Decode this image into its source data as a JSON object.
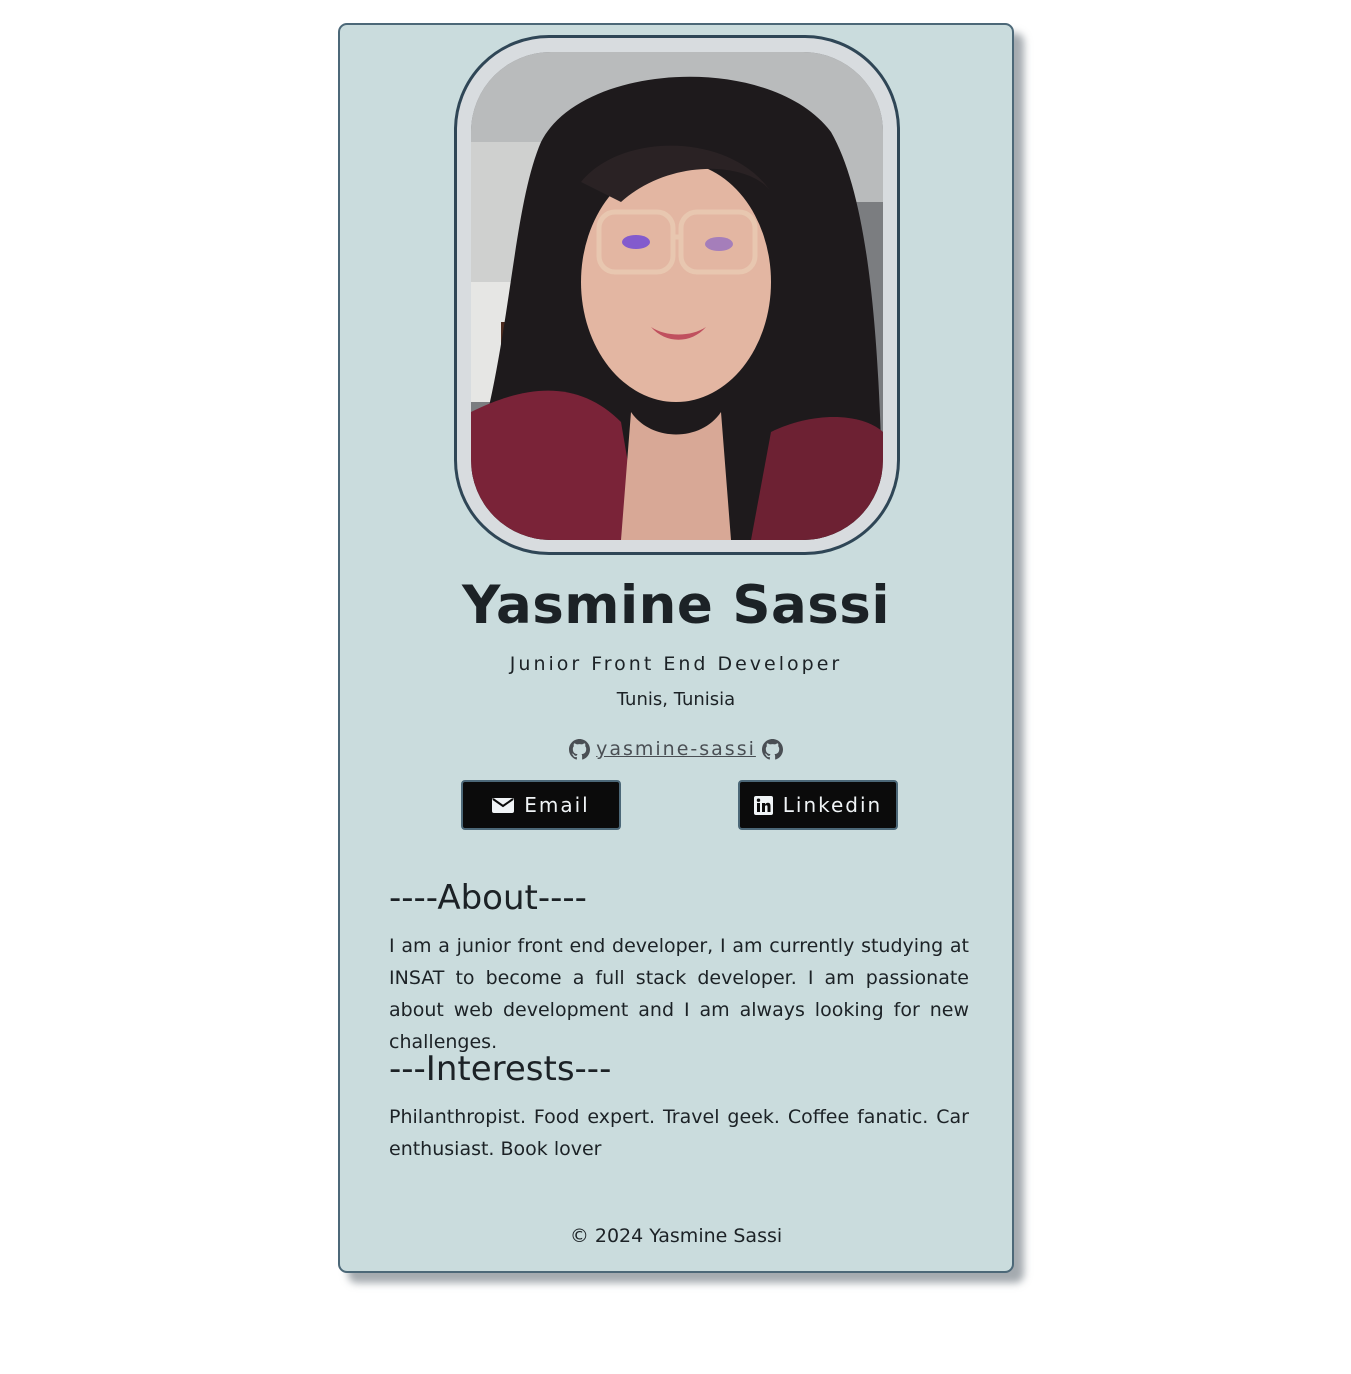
{
  "profile": {
    "name": "Yasmine Sassi",
    "role": "Junior Front End Developer",
    "location": "Tunis, Tunisia",
    "github_handle": "yasmine-sassi"
  },
  "buttons": {
    "email_label": "Email",
    "linkedin_label": "Linkedin"
  },
  "about": {
    "title": "----About----",
    "text": "I am a junior front end developer, I am currently studying at INSAT to become a full stack developer. I am passionate about web development and I am always looking for new challenges."
  },
  "interests": {
    "title": "---Interests---",
    "text": "Philanthropist. Food expert. Travel geek. Coffee fanatic. Car enthusiast. Book lover"
  },
  "footer": {
    "text": "© 2024 Yasmine Sassi"
  },
  "colors": {
    "card_background": "#cadcdd",
    "card_border": "#4c6878",
    "button_background": "#0b0b0b",
    "text": "#1c2226"
  },
  "icons": {
    "github": "github-icon",
    "email": "envelope-icon",
    "linkedin": "linkedin-icon"
  }
}
